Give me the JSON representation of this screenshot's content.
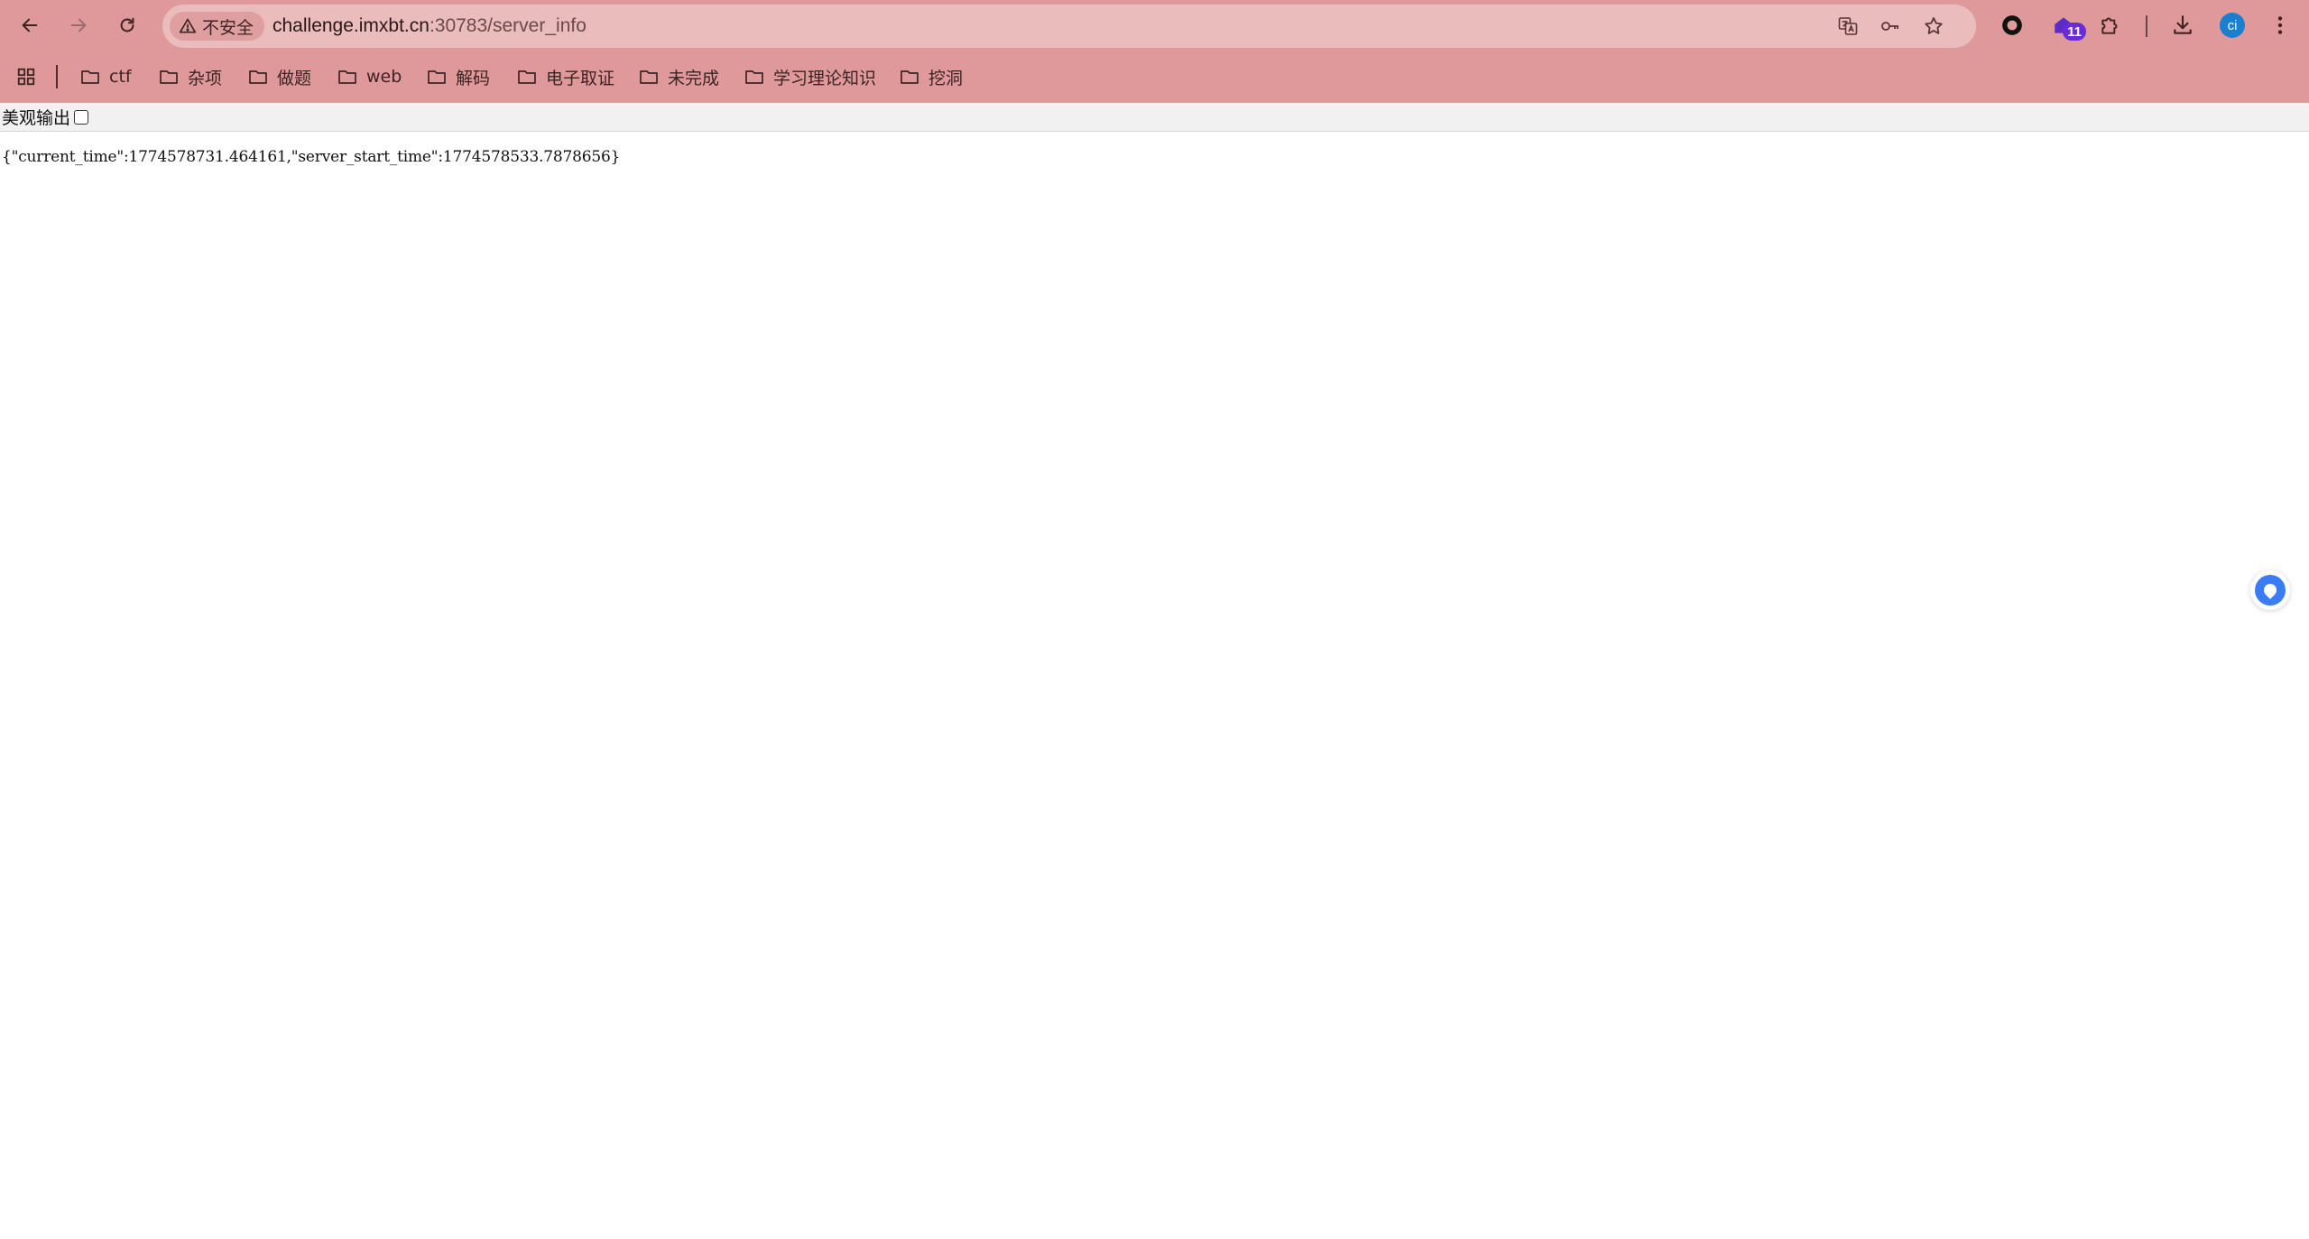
{
  "browser": {
    "security_label": "不安全",
    "url_host": "challenge.imxbt.cn",
    "url_rest": ":30783/server_info",
    "extension_badge": "11",
    "profile_initials": "ci"
  },
  "bookmarks": [
    {
      "label": "ctf"
    },
    {
      "label": "杂项"
    },
    {
      "label": "做题"
    },
    {
      "label": "web"
    },
    {
      "label": "解码"
    },
    {
      "label": "电子取证"
    },
    {
      "label": "未完成"
    },
    {
      "label": "学习理论知识"
    },
    {
      "label": "挖洞"
    }
  ],
  "page": {
    "pretty_print_label": "美观输出",
    "pretty_print_checked": false,
    "json_text": "{\"current_time\":1774578731.464161,\"server_start_time\":1774578533.7878656}"
  },
  "colors": {
    "chrome_bg": "#df999a",
    "omnibox_bg": "#ebbcbc",
    "profile": "#1b7fd1",
    "floating_button": "#3a7cf5"
  }
}
